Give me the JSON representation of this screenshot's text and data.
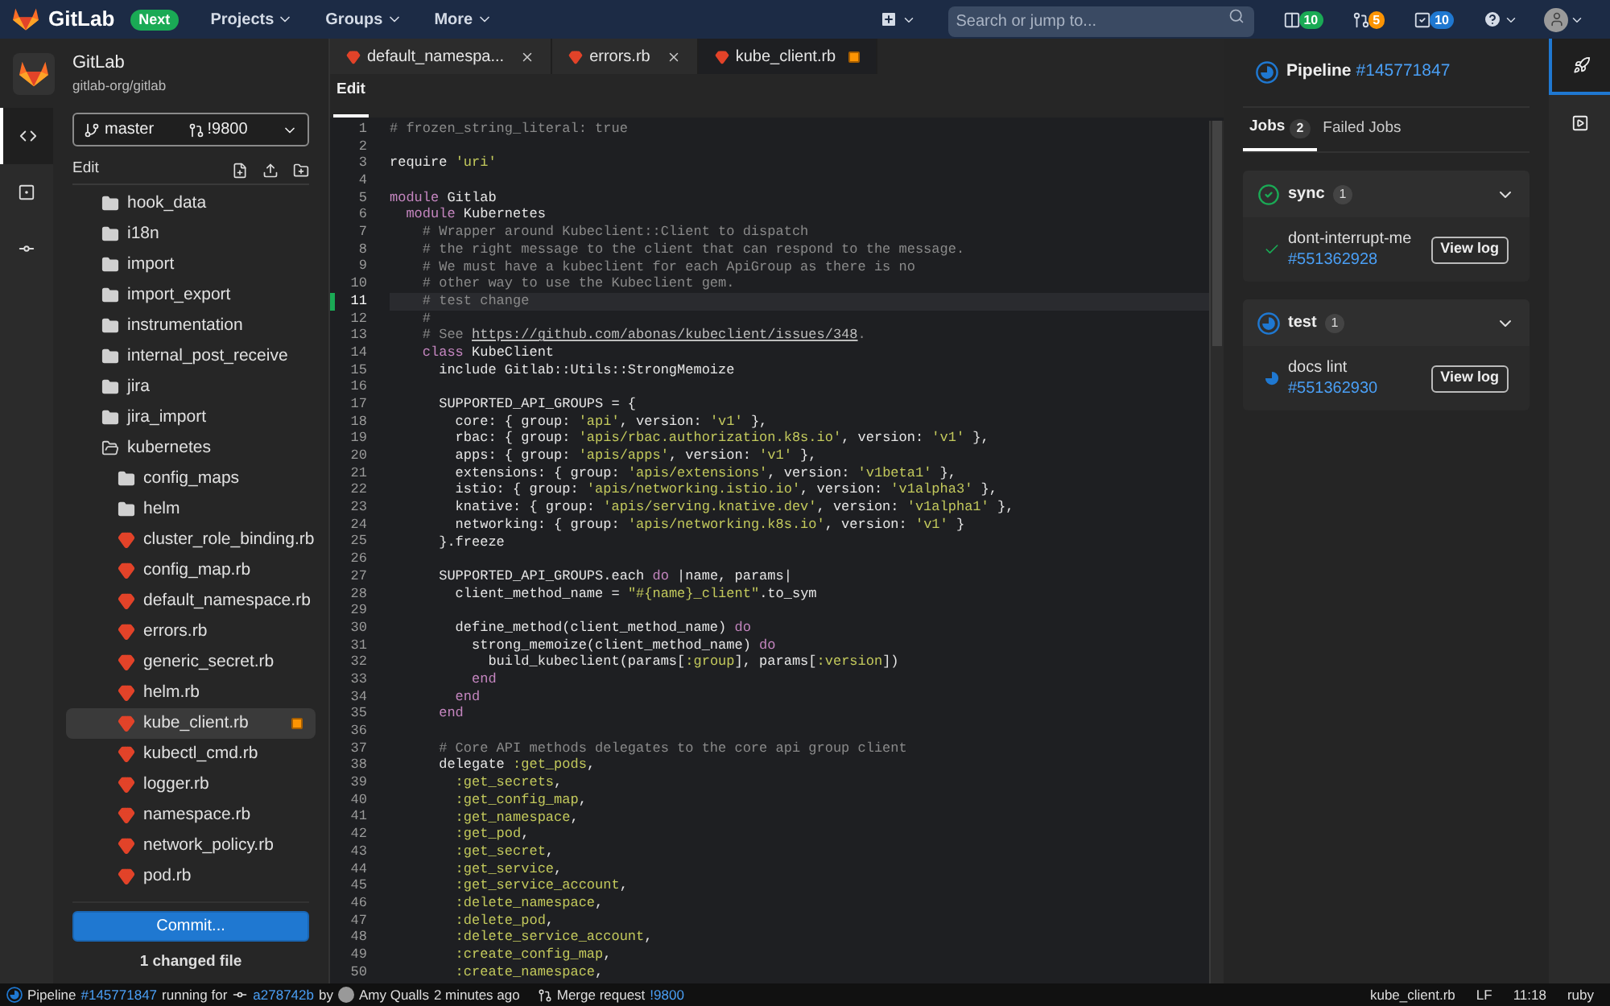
{
  "nav": {
    "brand": "GitLab",
    "badge": "Next",
    "menus": [
      "Projects",
      "Groups",
      "More"
    ],
    "search": {
      "placeholder": "Search or jump to..."
    },
    "counters": [
      {
        "kind": "issues",
        "count": "10",
        "color": "#1aaa55"
      },
      {
        "kind": "merge",
        "count": "5",
        "color": "#fc9403"
      },
      {
        "kind": "todos",
        "count": "10",
        "color": "#1f78d1"
      }
    ]
  },
  "rail": [
    {
      "kind": "code",
      "selected": true
    },
    {
      "kind": "review",
      "selected": false
    },
    {
      "kind": "commit",
      "selected": false
    }
  ],
  "project": {
    "name": "GitLab",
    "path": "gitlab-org/gitlab"
  },
  "branch": {
    "name": "master",
    "merge_request": "!9800"
  },
  "tree_header": "Edit",
  "tree": [
    {
      "kind": "folder",
      "name": "hook_data",
      "selected": false,
      "changed": false
    },
    {
      "kind": "folder",
      "name": "i18n",
      "selected": false,
      "changed": false
    },
    {
      "kind": "folder",
      "name": "import",
      "selected": false,
      "changed": false
    },
    {
      "kind": "folder",
      "name": "import_export",
      "selected": false,
      "changed": false
    },
    {
      "kind": "folder",
      "name": "instrumentation",
      "selected": false,
      "changed": false
    },
    {
      "kind": "folder",
      "name": "internal_post_receive",
      "selected": false,
      "changed": false
    },
    {
      "kind": "folder",
      "name": "jira",
      "selected": false,
      "changed": false
    },
    {
      "kind": "folder",
      "name": "jira_import",
      "selected": false,
      "changed": false
    },
    {
      "kind": "folder",
      "name": "kubernetes",
      "selected": false,
      "changed": false,
      "expanded": true,
      "children": [
        {
          "kind": "folder",
          "name": "config_maps",
          "selected": false,
          "changed": false
        },
        {
          "kind": "folder",
          "name": "helm",
          "selected": false,
          "changed": false
        },
        {
          "kind": "file",
          "name": "cluster_role_binding.rb",
          "selected": false,
          "changed": false
        },
        {
          "kind": "file",
          "name": "config_map.rb",
          "selected": false,
          "changed": false
        },
        {
          "kind": "file",
          "name": "default_namespace.rb",
          "selected": false,
          "changed": false
        },
        {
          "kind": "file",
          "name": "errors.rb",
          "selected": false,
          "changed": false
        },
        {
          "kind": "file",
          "name": "generic_secret.rb",
          "selected": false,
          "changed": false
        },
        {
          "kind": "file",
          "name": "helm.rb",
          "selected": false,
          "changed": false
        },
        {
          "kind": "file",
          "name": "kube_client.rb",
          "selected": true,
          "changed": true
        },
        {
          "kind": "file",
          "name": "kubectl_cmd.rb",
          "selected": false,
          "changed": false
        },
        {
          "kind": "file",
          "name": "logger.rb",
          "selected": false,
          "changed": false
        },
        {
          "kind": "file",
          "name": "namespace.rb",
          "selected": false,
          "changed": false
        },
        {
          "kind": "file",
          "name": "network_policy.rb",
          "selected": false,
          "changed": false
        },
        {
          "kind": "file",
          "name": "pod.rb",
          "selected": false,
          "changed": false
        }
      ]
    }
  ],
  "commit_button": "Commit...",
  "changed_count": "1 changed file",
  "tabs": [
    {
      "label": "default_namespa...",
      "selected": false,
      "changed": false
    },
    {
      "label": "errors.rb",
      "selected": false,
      "changed": false
    },
    {
      "label": "kube_client.rb",
      "selected": true,
      "changed": true
    }
  ],
  "editor_mode": "Edit",
  "code": [
    {
      "n": "1",
      "selected": false,
      "changed": false,
      "tokens": [
        {
          "kind": "comment",
          "text": "# frozen_string_literal: true"
        }
      ]
    },
    {
      "n": "2",
      "selected": false,
      "changed": false
    },
    {
      "n": "3",
      "selected": false,
      "changed": false,
      "tokens": [
        {
          "kind": "plain",
          "text": "require "
        },
        {
          "kind": "string",
          "text": "'uri'"
        }
      ]
    },
    {
      "n": "4",
      "selected": false,
      "changed": false
    },
    {
      "n": "5",
      "selected": false,
      "changed": false,
      "tokens": [
        {
          "kind": "keyword",
          "text": "module"
        },
        {
          "kind": "plain",
          "text": " Gitlab"
        }
      ]
    },
    {
      "n": "6",
      "selected": false,
      "changed": false,
      "tokens": [
        {
          "kind": "keyword",
          "text": "  module"
        },
        {
          "kind": "plain",
          "text": " Kubernetes"
        }
      ]
    },
    {
      "n": "7",
      "selected": false,
      "changed": false,
      "tokens": [
        {
          "kind": "comment",
          "text": "    # Wrapper around Kubeclient::Client to dispatch"
        }
      ]
    },
    {
      "n": "8",
      "selected": false,
      "changed": false,
      "tokens": [
        {
          "kind": "comment",
          "text": "    # the right message to the client that can respond to the message."
        }
      ]
    },
    {
      "n": "9",
      "selected": false,
      "changed": false,
      "tokens": [
        {
          "kind": "comment",
          "text": "    # We must have a kubeclient for each ApiGroup as there is no"
        }
      ]
    },
    {
      "n": "10",
      "selected": false,
      "changed": false,
      "tokens": [
        {
          "kind": "comment",
          "text": "    # other way to use the Kubeclient gem."
        }
      ]
    },
    {
      "n": "11",
      "selected": true,
      "changed": true,
      "tokens": [
        {
          "kind": "comment",
          "text": "    # test change"
        }
      ]
    },
    {
      "n": "12",
      "selected": false,
      "changed": false,
      "tokens": [
        {
          "kind": "comment",
          "text": "    #"
        }
      ]
    },
    {
      "n": "13",
      "selected": false,
      "changed": false,
      "tokens": [
        {
          "kind": "comment",
          "text": "    # See "
        },
        {
          "kind": "link",
          "text": "https://github.com/abonas/kubeclient/issues/348"
        },
        {
          "kind": "comment",
          "text": "."
        }
      ]
    },
    {
      "n": "14",
      "selected": false,
      "changed": false,
      "tokens": [
        {
          "kind": "keyword",
          "text": "    class"
        },
        {
          "kind": "plain",
          "text": " KubeClient"
        }
      ]
    },
    {
      "n": "15",
      "selected": false,
      "changed": false,
      "tokens": [
        {
          "kind": "plain",
          "text": "      include Gitlab::Utils::StrongMemoize"
        }
      ]
    },
    {
      "n": "16",
      "selected": false,
      "changed": false
    },
    {
      "n": "17",
      "selected": false,
      "changed": false,
      "tokens": [
        {
          "kind": "plain",
          "text": "      SUPPORTED_API_GROUPS = {"
        }
      ]
    },
    {
      "n": "18",
      "selected": false,
      "changed": false,
      "tokens": [
        {
          "kind": "plain",
          "text": "        core: { group: "
        },
        {
          "kind": "string",
          "text": "'api'"
        },
        {
          "kind": "plain",
          "text": ", version: "
        },
        {
          "kind": "string",
          "text": "'v1'"
        },
        {
          "kind": "plain",
          "text": " },"
        }
      ]
    },
    {
      "n": "19",
      "selected": false,
      "changed": false,
      "tokens": [
        {
          "kind": "plain",
          "text": "        rbac: { group: "
        },
        {
          "kind": "string",
          "text": "'apis/rbac.authorization.k8s.io'"
        },
        {
          "kind": "plain",
          "text": ", version: "
        },
        {
          "kind": "string",
          "text": "'v1'"
        },
        {
          "kind": "plain",
          "text": " },"
        }
      ]
    },
    {
      "n": "20",
      "selected": false,
      "changed": false,
      "tokens": [
        {
          "kind": "plain",
          "text": "        apps: { group: "
        },
        {
          "kind": "string",
          "text": "'apis/apps'"
        },
        {
          "kind": "plain",
          "text": ", version: "
        },
        {
          "kind": "string",
          "text": "'v1'"
        },
        {
          "kind": "plain",
          "text": " },"
        }
      ]
    },
    {
      "n": "21",
      "selected": false,
      "changed": false,
      "tokens": [
        {
          "kind": "plain",
          "text": "        extensions: { group: "
        },
        {
          "kind": "string",
          "text": "'apis/extensions'"
        },
        {
          "kind": "plain",
          "text": ", version: "
        },
        {
          "kind": "string",
          "text": "'v1beta1'"
        },
        {
          "kind": "plain",
          "text": " },"
        }
      ]
    },
    {
      "n": "22",
      "selected": false,
      "changed": false,
      "tokens": [
        {
          "kind": "plain",
          "text": "        istio: { group: "
        },
        {
          "kind": "string",
          "text": "'apis/networking.istio.io'"
        },
        {
          "kind": "plain",
          "text": ", version: "
        },
        {
          "kind": "string",
          "text": "'v1alpha3'"
        },
        {
          "kind": "plain",
          "text": " },"
        }
      ]
    },
    {
      "n": "23",
      "selected": false,
      "changed": false,
      "tokens": [
        {
          "kind": "plain",
          "text": "        knative: { group: "
        },
        {
          "kind": "string",
          "text": "'apis/serving.knative.dev'"
        },
        {
          "kind": "plain",
          "text": ", version: "
        },
        {
          "kind": "string",
          "text": "'v1alpha1'"
        },
        {
          "kind": "plain",
          "text": " },"
        }
      ]
    },
    {
      "n": "24",
      "selected": false,
      "changed": false,
      "tokens": [
        {
          "kind": "plain",
          "text": "        networking: { group: "
        },
        {
          "kind": "string",
          "text": "'apis/networking.k8s.io'"
        },
        {
          "kind": "plain",
          "text": ", version: "
        },
        {
          "kind": "string",
          "text": "'v1'"
        },
        {
          "kind": "plain",
          "text": " }"
        }
      ]
    },
    {
      "n": "25",
      "selected": false,
      "changed": false,
      "tokens": [
        {
          "kind": "plain",
          "text": "      }.freeze"
        }
      ]
    },
    {
      "n": "26",
      "selected": false,
      "changed": false
    },
    {
      "n": "27",
      "selected": false,
      "changed": false,
      "tokens": [
        {
          "kind": "plain",
          "text": "      SUPPORTED_API_GROUPS.each "
        },
        {
          "kind": "keyword",
          "text": "do"
        },
        {
          "kind": "plain",
          "text": " |name, params|"
        }
      ]
    },
    {
      "n": "28",
      "selected": false,
      "changed": false,
      "tokens": [
        {
          "kind": "plain",
          "text": "        client_method_name = "
        },
        {
          "kind": "string",
          "text": "\"#{name}_client\""
        },
        {
          "kind": "plain",
          "text": ".to_sym"
        }
      ]
    },
    {
      "n": "29",
      "selected": false,
      "changed": false
    },
    {
      "n": "30",
      "selected": false,
      "changed": false,
      "tokens": [
        {
          "kind": "plain",
          "text": "        define_method(client_method_name) "
        },
        {
          "kind": "keyword",
          "text": "do"
        }
      ]
    },
    {
      "n": "31",
      "selected": false,
      "changed": false,
      "tokens": [
        {
          "kind": "plain",
          "text": "          strong_memoize(client_method_name) "
        },
        {
          "kind": "keyword",
          "text": "do"
        }
      ]
    },
    {
      "n": "32",
      "selected": false,
      "changed": false,
      "tokens": [
        {
          "kind": "plain",
          "text": "            build_kubeclient(params["
        },
        {
          "kind": "string",
          "text": ":group"
        },
        {
          "kind": "plain",
          "text": "], params["
        },
        {
          "kind": "string",
          "text": ":version"
        },
        {
          "kind": "plain",
          "text": "])"
        }
      ]
    },
    {
      "n": "33",
      "selected": false,
      "changed": false,
      "tokens": [
        {
          "kind": "keyword",
          "text": "          end"
        }
      ]
    },
    {
      "n": "34",
      "selected": false,
      "changed": false,
      "tokens": [
        {
          "kind": "keyword",
          "text": "        end"
        }
      ]
    },
    {
      "n": "35",
      "selected": false,
      "changed": false,
      "tokens": [
        {
          "kind": "keyword",
          "text": "      end"
        }
      ]
    },
    {
      "n": "36",
      "selected": false,
      "changed": false
    },
    {
      "n": "37",
      "selected": false,
      "changed": false,
      "tokens": [
        {
          "kind": "comment",
          "text": "      # Core API methods delegates to the core api group client"
        }
      ]
    },
    {
      "n": "38",
      "selected": false,
      "changed": false,
      "tokens": [
        {
          "kind": "plain",
          "text": "      delegate "
        },
        {
          "kind": "string",
          "text": ":get_pods"
        },
        {
          "kind": "plain",
          "text": ","
        }
      ]
    },
    {
      "n": "39",
      "selected": false,
      "changed": false,
      "tokens": [
        {
          "kind": "string",
          "text": "        :get_secrets"
        },
        {
          "kind": "plain",
          "text": ","
        }
      ]
    },
    {
      "n": "40",
      "selected": false,
      "changed": false,
      "tokens": [
        {
          "kind": "string",
          "text": "        :get_config_map"
        },
        {
          "kind": "plain",
          "text": ","
        }
      ]
    },
    {
      "n": "41",
      "selected": false,
      "changed": false,
      "tokens": [
        {
          "kind": "string",
          "text": "        :get_namespace"
        },
        {
          "kind": "plain",
          "text": ","
        }
      ]
    },
    {
      "n": "42",
      "selected": false,
      "changed": false,
      "tokens": [
        {
          "kind": "string",
          "text": "        :get_pod"
        },
        {
          "kind": "plain",
          "text": ","
        }
      ]
    },
    {
      "n": "43",
      "selected": false,
      "changed": false,
      "tokens": [
        {
          "kind": "string",
          "text": "        :get_secret"
        },
        {
          "kind": "plain",
          "text": ","
        }
      ]
    },
    {
      "n": "44",
      "selected": false,
      "changed": false,
      "tokens": [
        {
          "kind": "string",
          "text": "        :get_service"
        },
        {
          "kind": "plain",
          "text": ","
        }
      ]
    },
    {
      "n": "45",
      "selected": false,
      "changed": false,
      "tokens": [
        {
          "kind": "string",
          "text": "        :get_service_account"
        },
        {
          "kind": "plain",
          "text": ","
        }
      ]
    },
    {
      "n": "46",
      "selected": false,
      "changed": false,
      "tokens": [
        {
          "kind": "string",
          "text": "        :delete_namespace"
        },
        {
          "kind": "plain",
          "text": ","
        }
      ]
    },
    {
      "n": "47",
      "selected": false,
      "changed": false,
      "tokens": [
        {
          "kind": "string",
          "text": "        :delete_pod"
        },
        {
          "kind": "plain",
          "text": ","
        }
      ]
    },
    {
      "n": "48",
      "selected": false,
      "changed": false,
      "tokens": [
        {
          "kind": "string",
          "text": "        :delete_service_account"
        },
        {
          "kind": "plain",
          "text": ","
        }
      ]
    },
    {
      "n": "49",
      "selected": false,
      "changed": false,
      "tokens": [
        {
          "kind": "string",
          "text": "        :create_config_map"
        },
        {
          "kind": "plain",
          "text": ","
        }
      ]
    },
    {
      "n": "50",
      "selected": false,
      "changed": false,
      "tokens": [
        {
          "kind": "string",
          "text": "        :create_namespace"
        },
        {
          "kind": "plain",
          "text": ","
        }
      ]
    }
  ],
  "pipeline_panel": {
    "kind": "running",
    "title": "Pipeline",
    "id": "#145771847",
    "tabs": [
      {
        "label": "Jobs",
        "count": "2",
        "selected": true
      },
      {
        "label": "Failed Jobs",
        "selected": false
      }
    ],
    "stages": [
      {
        "name": "sync",
        "count": "1",
        "kind": "success",
        "expanded": true,
        "jobs": [
          {
            "name": "dont-interrupt-me",
            "id": "#551362928",
            "kind": "success",
            "button": "View log"
          }
        ]
      },
      {
        "name": "test",
        "count": "1",
        "kind": "running",
        "expanded": true,
        "jobs": [
          {
            "name": "docs lint",
            "id": "#551362930",
            "kind": "running",
            "button": "View log"
          }
        ]
      }
    ]
  },
  "right_rail": [
    {
      "kind": "pipeline",
      "selected": true
    },
    {
      "kind": "preview",
      "selected": false
    }
  ],
  "status_bar": {
    "pipeline": {
      "kind": "running",
      "label": "Pipeline",
      "id": "#145771847"
    },
    "running_text": "running for",
    "commit": "a278742b",
    "by": "by",
    "author": "Amy Qualls",
    "time": "2 minutes ago",
    "mr_label": "Merge request",
    "mr_id": "!9800",
    "file": "kube_client.rb",
    "eol": "LF",
    "position": "11:18",
    "language": "ruby"
  }
}
